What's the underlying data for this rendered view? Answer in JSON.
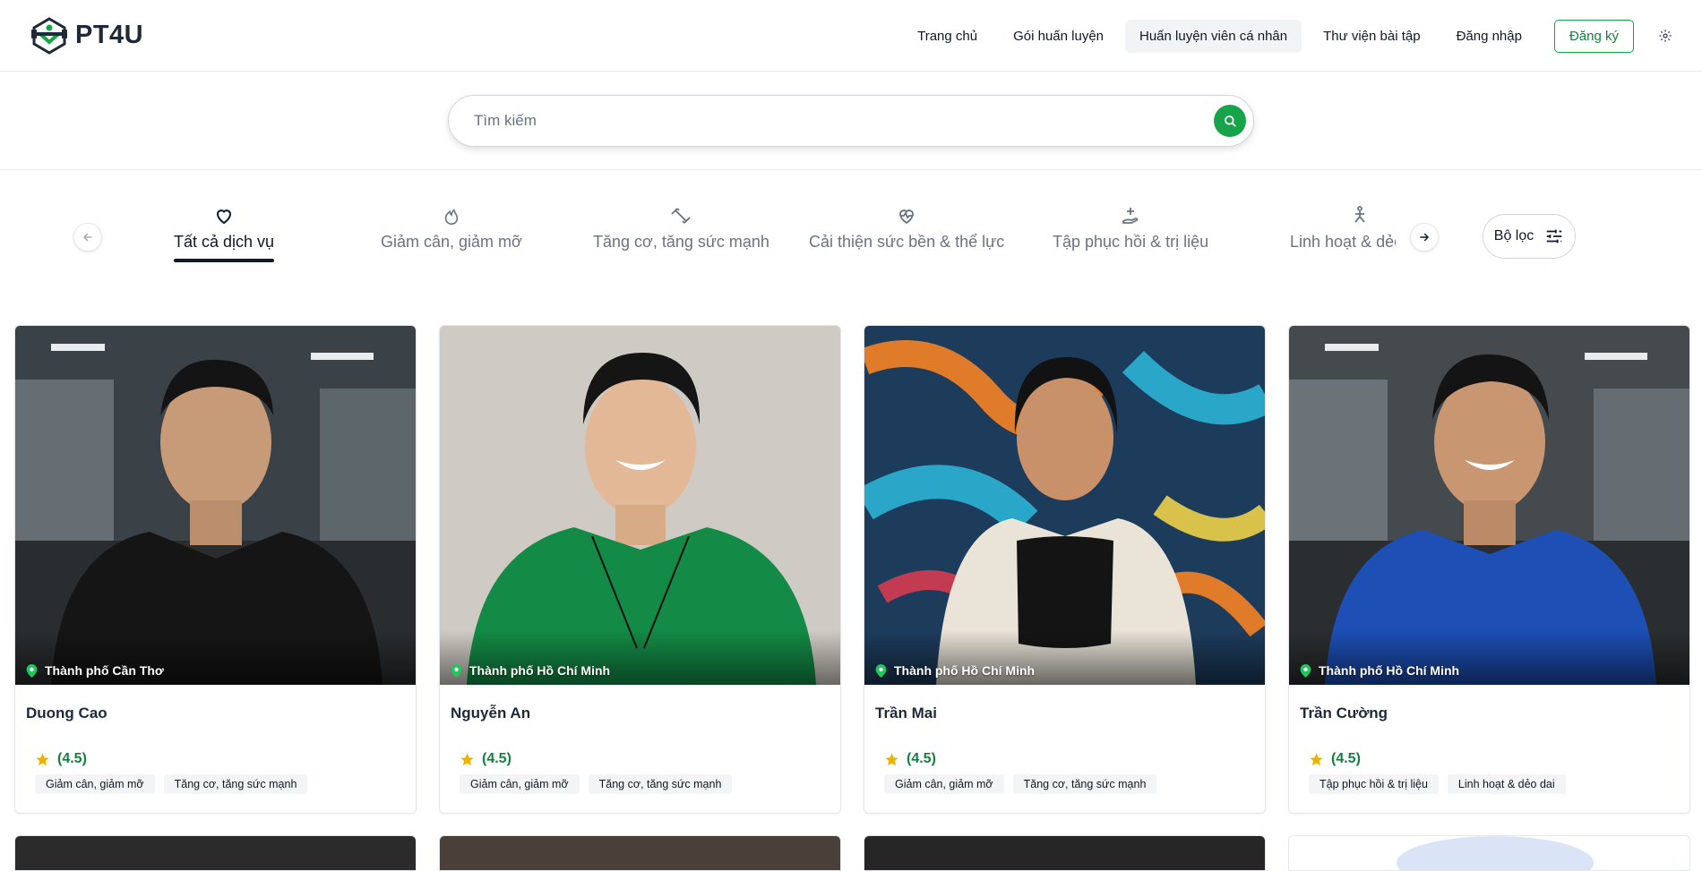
{
  "brand": {
    "name": "PT4U"
  },
  "nav": {
    "items": [
      {
        "label": "Trang chủ"
      },
      {
        "label": "Gói huấn luyện"
      },
      {
        "label": "Huấn luyện viên cá nhân"
      },
      {
        "label": "Thư viện bài tập"
      },
      {
        "label": "Đăng nhập"
      }
    ],
    "register_label": "Đăng ký",
    "active_index": 2
  },
  "search": {
    "placeholder": "Tìm kiếm"
  },
  "categories": [
    {
      "label": "Tất cả dịch vụ",
      "icon": "heart-icon"
    },
    {
      "label": "Giảm cân, giảm mỡ",
      "icon": "flame-icon"
    },
    {
      "label": "Tăng cơ, tăng sức mạnh",
      "icon": "dumbbell-icon"
    },
    {
      "label": "Cải thiện sức bền & thể lực",
      "icon": "heart-pulse-icon"
    },
    {
      "label": "Tập phục hồi & trị liệu",
      "icon": "hand-plus-icon"
    },
    {
      "label": "Linh hoạt & dẻo dai",
      "icon": "stretch-icon"
    }
  ],
  "filter": {
    "label": "Bộ lọc"
  },
  "colors": {
    "accent": "#16a34a",
    "accent_dark": "#15803d",
    "star": "#eab308"
  },
  "trainers": [
    {
      "name": "Duong Cao",
      "location": "Thành phố Cần Thơ",
      "rating": "(4.5)",
      "tags": [
        "Giảm cân, giảm mỡ",
        "Tăng cơ, tăng sức mạnh"
      ],
      "shirt": "#151515",
      "bg": "gym"
    },
    {
      "name": "Nguyễn An",
      "location": "Thành phố Hồ Chí Minh",
      "rating": "(4.5)",
      "tags": [
        "Giảm cân, giảm mỡ",
        "Tăng cơ, tăng sức mạnh"
      ],
      "shirt": "#138a45",
      "bg": "studio"
    },
    {
      "name": "Trần Mai",
      "location": "Thành phố Hồ Chí Minh",
      "rating": "(4.5)",
      "tags": [
        "Giảm cân, giảm mỡ",
        "Tăng cơ, tăng sức mạnh"
      ],
      "shirt": "#e9e3d8",
      "bg": "graffiti"
    },
    {
      "name": "Trần Cường",
      "location": "Thành phố Hồ Chí Minh",
      "rating": "(4.5)",
      "tags": [
        "Tập phục hồi & trị liệu",
        "Linh hoạt & dẻo dai"
      ],
      "shirt": "#1d4fb5",
      "bg": "gym"
    }
  ]
}
